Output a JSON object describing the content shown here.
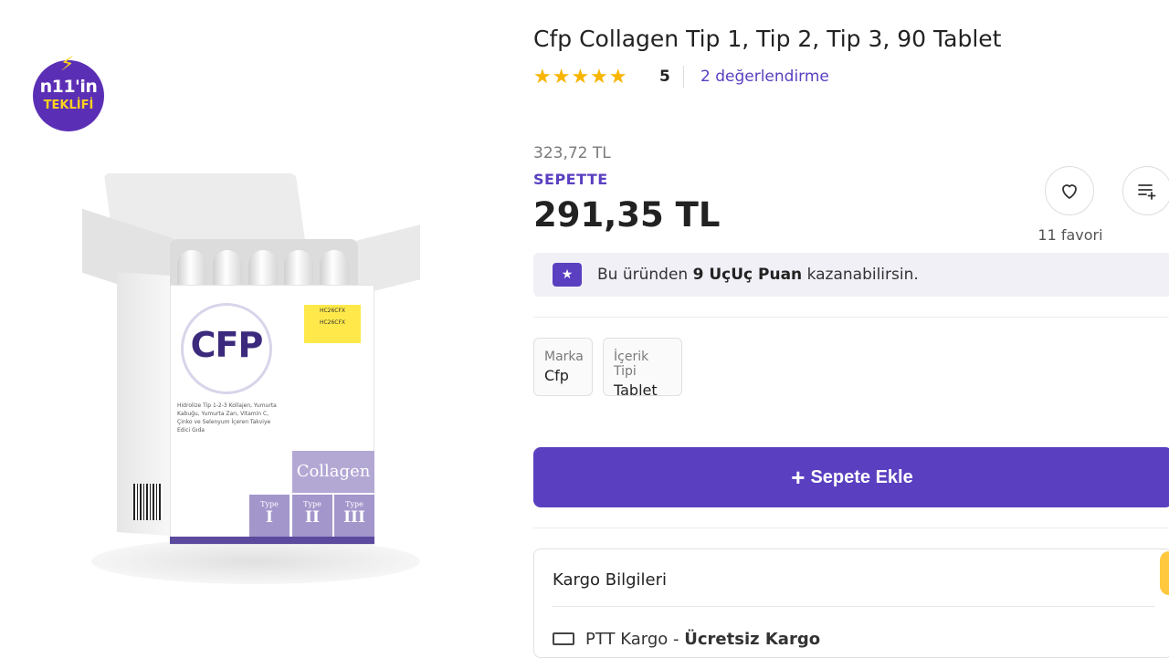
{
  "badge": {
    "line1": "n11'in",
    "line2": "TEKLİFİ"
  },
  "product_image": {
    "brand": "CFP",
    "code_label": "HC26CFX",
    "description": "Hidrolize Tip 1-2-3 Kollajen, Yumurta Kabuğu, Yumurta Zarı, Vitamin C, Çinko ve Selenyum İçeren Takviye Edici Gıda",
    "collagen_label": "Collagen",
    "types": [
      {
        "label": "Type",
        "numeral": "I"
      },
      {
        "label": "Type",
        "numeral": "II"
      },
      {
        "label": "Type",
        "numeral": "III"
      }
    ]
  },
  "product": {
    "title": "Cfp Collagen Tip 1, Tip 2, Tip 3, 90 Tablet",
    "stars": "★★★★★",
    "rating": "5",
    "review_count_label": "2 değerlendirme",
    "old_price": "323,72 TL",
    "cart_label": "SEPETTE",
    "price": "291,35 TL",
    "favorite_count_label": "11 favori"
  },
  "points": {
    "prefix": "Bu üründen ",
    "amount": "9 UçUç Puan",
    "suffix": " kazanabilirsin."
  },
  "attributes": [
    {
      "key": "Marka",
      "value": "Cfp"
    },
    {
      "key": "İçerik Tipi",
      "value": "Tablet"
    }
  ],
  "actions": {
    "add_to_cart": "Sepete Ekle"
  },
  "shipping": {
    "title": "Kargo Bilgileri",
    "carrier": "PTT Kargo",
    "separator": " - ",
    "cost": "Ücretsiz Kargo"
  },
  "colors": {
    "accent": "#5a3fc0",
    "star": "#f7b500",
    "badge": "#5b2fb5"
  }
}
